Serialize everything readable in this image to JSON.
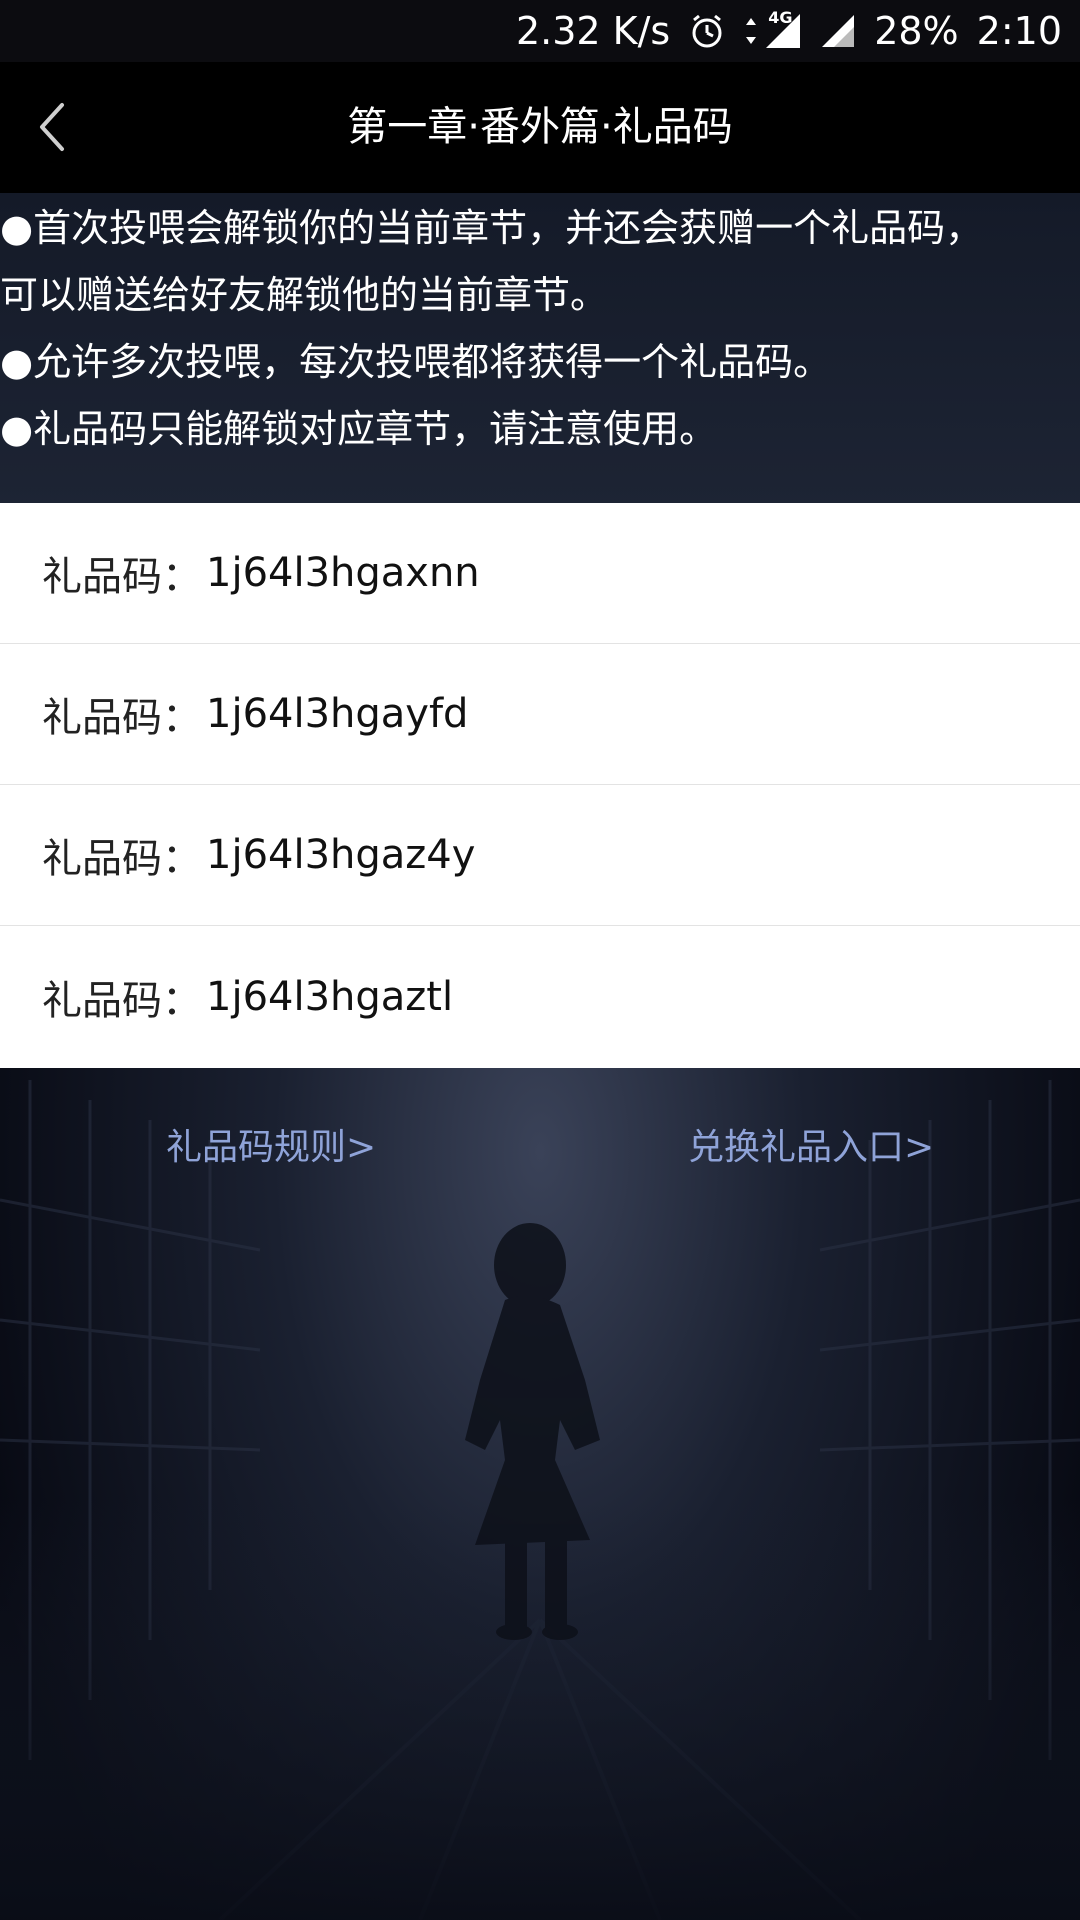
{
  "status_bar": {
    "speed": "2.32 K/s",
    "network": "4G",
    "battery": "28%",
    "time": "2:10",
    "icons": [
      "alarm-icon",
      "data-arrows-icon",
      "signal-4g-icon",
      "signal-icon"
    ]
  },
  "header": {
    "back_icon": "chevron-left-icon",
    "title": "第一章·番外篇·礼品码"
  },
  "info": {
    "lines": [
      "●首次投喂会解锁你的当前章节，并还会获赠一个礼品码，",
      "可以赠送给好友解锁他的当前章节。",
      "●允许多次投喂，每次投喂都将获得一个礼品码。",
      "●礼品码只能解锁对应章节，请注意使用。"
    ]
  },
  "codes": {
    "label": "礼品码：",
    "items": [
      "1j64l3hgaxnn",
      "1j64l3hgayfd",
      "1j64l3hgaz4y",
      "1j64l3hgaztl"
    ]
  },
  "links": {
    "rules": "礼品码规则>",
    "redeem": "兑换礼品入口>"
  },
  "colors": {
    "nav_background": "#000000",
    "link": "#8fa3d8",
    "list_background": "#ffffff",
    "scene_background": "#0b0e18"
  }
}
